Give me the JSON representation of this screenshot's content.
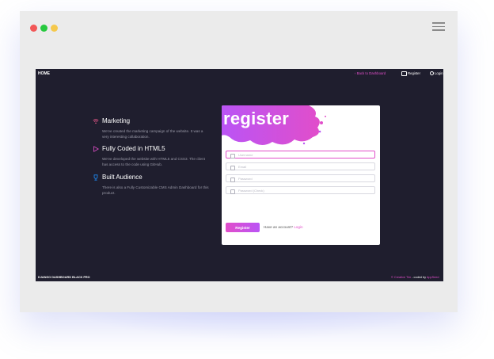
{
  "window": {
    "menu_icon": "hamburger-icon"
  },
  "nav": {
    "brand": "HOME",
    "back_label": "Back to Dashboard",
    "register_label": "Register",
    "login_label": "Login"
  },
  "features": [
    {
      "icon": "wifi-icon",
      "title": "Marketing",
      "text": "We've created the marketing campaign of the website. It was a very interesting collaboration."
    },
    {
      "icon": "triangle-icon",
      "title": "Fully Coded in HTML5",
      "text": "We've developed the website with HTML5 and CSS3. The client has access to the code using GitHub."
    },
    {
      "icon": "trophy-icon",
      "title": "Built Audience",
      "text": "There is also a Fully Customizable CMS Admin Dashboard for this product."
    }
  ],
  "form": {
    "title": "register",
    "fields": [
      {
        "placeholder": "Username",
        "icon": "user-icon"
      },
      {
        "placeholder": "Email",
        "icon": "email-icon"
      },
      {
        "placeholder": "Password",
        "icon": "lock-icon"
      },
      {
        "placeholder": "Password (Check)",
        "icon": "lock-icon"
      }
    ],
    "button_label": "Register",
    "have_account": "Have an account?",
    "login_link": "Login"
  },
  "footer": {
    "left": "DJANGO DASHBOARD BLACK PRO",
    "right_symbol": "©",
    "right_link": "Creative Tim",
    "right_text": " - coded by ",
    "right_author": "AppSeed"
  },
  "colors": {
    "accent": "#e14eca",
    "purple": "#ba54f5",
    "background": "#1f1e2e",
    "wifi": "#fd5d93",
    "triangle": "#e14eca",
    "trophy": "#1d8cf8"
  }
}
